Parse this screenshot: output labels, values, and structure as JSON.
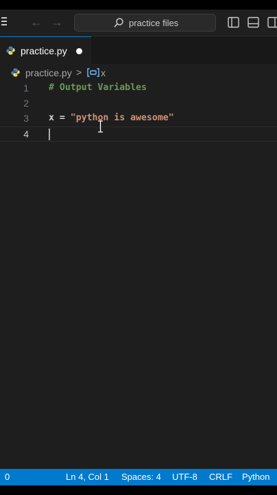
{
  "title_bar": {
    "search_text": "practice files"
  },
  "tabs": [
    {
      "label": "practice.py",
      "modified": true
    }
  ],
  "breadcrumb": {
    "file": "practice.py",
    "separator": ">",
    "symbol": "x"
  },
  "editor": {
    "lines": [
      {
        "number": "1",
        "tokens": [
          {
            "type": "comment",
            "text": "# Output Variables"
          }
        ]
      },
      {
        "number": "2",
        "tokens": []
      },
      {
        "number": "3",
        "tokens": [
          {
            "type": "var",
            "text": "x"
          },
          {
            "type": "op",
            "text": " = "
          },
          {
            "type": "str",
            "text": "\"python is awesome\""
          }
        ]
      },
      {
        "number": "4",
        "tokens": [],
        "current": true
      }
    ]
  },
  "status_bar": {
    "problems": "0",
    "cursor": "Ln 4, Col 1",
    "spaces": "Spaces: 4",
    "encoding": "UTF-8",
    "eol": "CRLF",
    "language": "Python"
  },
  "colors": {
    "accent": "#007acc",
    "comment": "#6a9955",
    "string": "#ce9178"
  }
}
